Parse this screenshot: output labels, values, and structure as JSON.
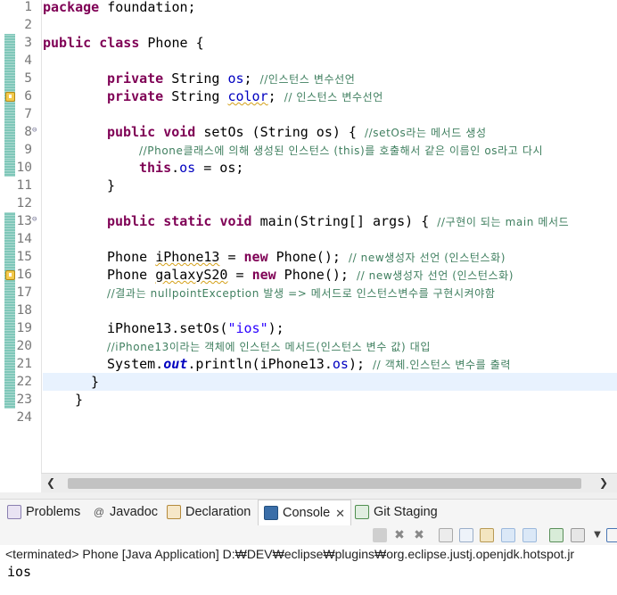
{
  "editor": {
    "line_numbers": [
      "1",
      "2",
      "3",
      "4",
      "5",
      "6",
      "7",
      "8",
      "9",
      "10",
      "11",
      "12",
      "13",
      "14",
      "15",
      "16",
      "17",
      "18",
      "19",
      "20",
      "21",
      "22",
      "23",
      "24"
    ],
    "l1": {
      "kw": "package",
      "rest": " foundation;"
    },
    "l3": {
      "kw1": "public",
      "kw2": "class",
      "rest": " Phone {"
    },
    "l5": {
      "kw": "private",
      "type": " String ",
      "field": "os",
      "semi": "; ",
      "cm": "//인스턴스 변수선언"
    },
    "l6": {
      "kw": "private",
      "type": " String ",
      "field": "color",
      "semi": "; ",
      "cm": "// 인스턴스 변수선언"
    },
    "l8": {
      "kw1": "public",
      "kw2": "void",
      "rest": " setOs (String os) { ",
      "cm": "//setOs라는 메서드 생성"
    },
    "l9": {
      "cm": "//Phone클래스에 의해 생성된 인스턴스 (this)를 호출해서 같은 이름인 os라고 다시"
    },
    "l10": {
      "kw": "this",
      "dot": ".",
      "field": "os",
      "rest": " = os;"
    },
    "l11": {
      "text": "}"
    },
    "l13": {
      "kw1": "public",
      "kw2": "static",
      "kw3": "void",
      "rest": " main(String[] args) { ",
      "cm": "//구현이 되는 main 메서드"
    },
    "l15": {
      "a": "Phone ",
      "var": "iPhone13",
      "b": " = ",
      "kw": "new",
      "c": " Phone(); ",
      "cm": "// new생성자 선언 (인스턴스화)"
    },
    "l16": {
      "a": "Phone ",
      "var": "galaxyS20",
      "b": " = ",
      "kw": "new",
      "c": " Phone(); ",
      "cm": "// new생성자 선언 (인스턴스화)"
    },
    "l17": {
      "cm": "//결과는 nullpointException 발생 => 메서드로 인스턴스변수를 구현시켜야함"
    },
    "l19": {
      "a": "iPhone13.setOs(",
      "st": "\"ios\"",
      "b": ");"
    },
    "l20": {
      "cm": "//iPhone13이라는 객체에 인스턴스 메서드(인스턴스 변수 값) 대입"
    },
    "l21": {
      "a": "System.",
      "sf": "out",
      "b": ".println(iPhone13.",
      "field": "os",
      "c": "); ",
      "cm": "// 객체.인스턴스 변수를 출력"
    },
    "l22": {
      "text": "}"
    },
    "l23": {
      "text": "}"
    }
  },
  "tabs": [
    {
      "label": "Problems",
      "icon": "problems-icon"
    },
    {
      "label": "Javadoc",
      "icon": "javadoc-icon"
    },
    {
      "label": "Declaration",
      "icon": "declaration-icon"
    },
    {
      "label": "Console",
      "icon": "console-icon",
      "active": true
    },
    {
      "label": "Git Staging",
      "icon": "git-staging-icon"
    }
  ],
  "console": {
    "terminated": "<terminated> Phone [Java Application] D:₩DEV₩eclipse₩plugins₩org.eclipse.justj.openjdk.hotspot.jr",
    "output": "ios"
  },
  "colors": {
    "keyword": "#7f0055",
    "comment": "#3f7f5f",
    "string": "#2a00ff",
    "field": "#0000c0",
    "coverage": "#7fc7b9",
    "current_line": "#e8f2fe"
  }
}
